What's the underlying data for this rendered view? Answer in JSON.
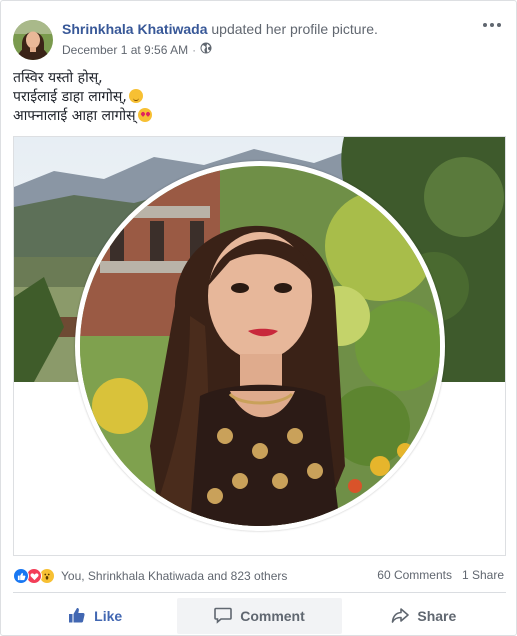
{
  "post": {
    "author": "Shrinkhala Khatiwada",
    "action": "updated her profile picture.",
    "timestamp": "December 1 at 9:56 AM",
    "separator": "·",
    "privacy_icon": "globe-icon",
    "menu_icon": "more-options-icon",
    "caption_lines": [
      "तस्विर यस्तो होस्,",
      "पराईलाई डाहा लागोस्,",
      "आफ्नालाई आहा लागोस्"
    ],
    "caption_emojis": [
      "relieved-face-emoji",
      "heart-eyes-emoji"
    ]
  },
  "reactions": {
    "icons": [
      "like-reaction-icon",
      "love-reaction-icon",
      "wow-reaction-icon"
    ],
    "summary": "You, Shrinkhala Khatiwada and 823 others",
    "comments": "60 Comments",
    "shares": "1 Share"
  },
  "action_bar": {
    "like_label": "Like",
    "comment_label": "Comment",
    "share_label": "Share"
  },
  "colors": {
    "author_link": "#385898",
    "like_active": "#4267b2",
    "like_reaction": "#1877f2",
    "love_reaction": "#f33e58",
    "wow_reaction": "#f7c033"
  }
}
